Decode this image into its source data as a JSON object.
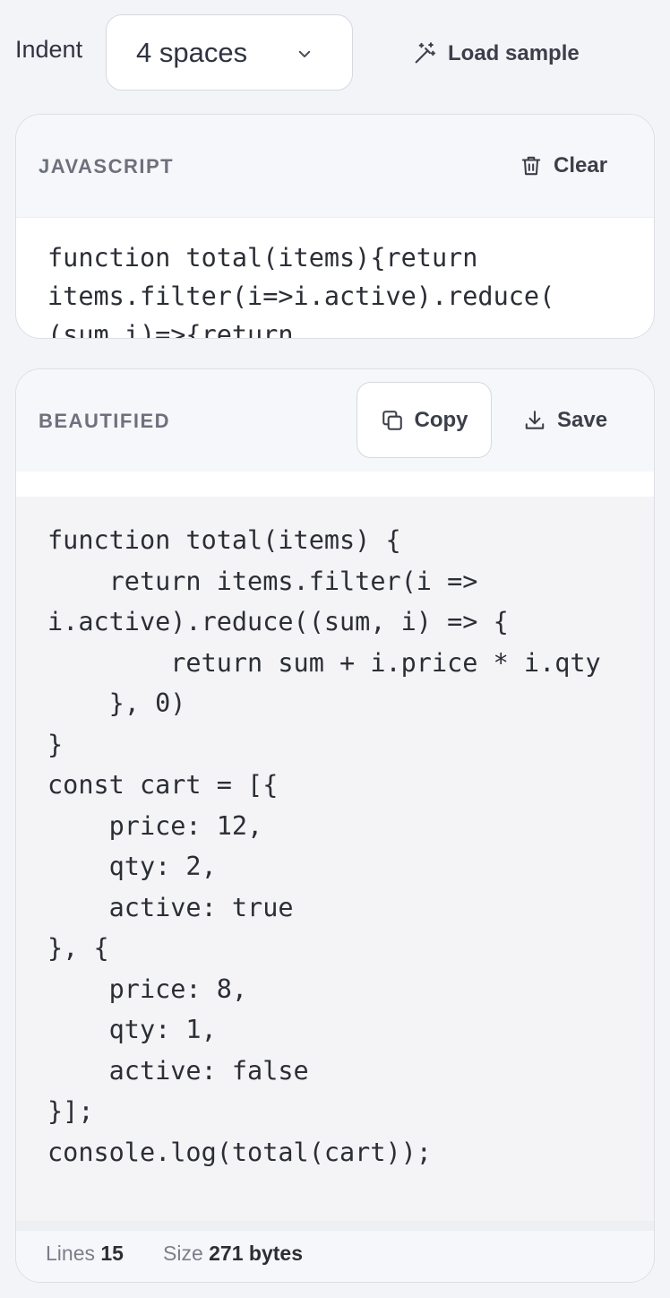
{
  "toolbar": {
    "indent_label": "Indent",
    "indent_value": "4 spaces",
    "load_sample_label": "Load sample"
  },
  "input_panel": {
    "title": "JAVASCRIPT",
    "clear_label": "Clear",
    "code": "function total(items){return\nitems.filter(i=>i.active).reduce(\n(sum,i)=>{return"
  },
  "output_panel": {
    "title": "BEAUTIFIED",
    "copy_label": "Copy",
    "save_label": "Save",
    "code": "function total(items) {\n    return items.filter(i =>\ni.active).reduce((sum, i) => {\n        return sum + i.price * i.qty\n    }, 0)\n}\nconst cart = [{\n    price: 12,\n    qty: 2,\n    active: true\n}, {\n    price: 8,\n    qty: 1,\n    active: false\n}];\nconsole.log(total(cart));"
  },
  "stats": {
    "lines_label": "Lines",
    "lines_value": "15",
    "size_label": "Size",
    "size_value": "271 bytes"
  },
  "colors": {
    "page_bg": "#f3f4f8",
    "card_bg": "#ffffff",
    "header_bg": "#f6f7fa",
    "code_area_bg": "#f4f4f6",
    "muted_text": "#6c717c",
    "text": "#2b2e35"
  },
  "icons": {
    "indent_dropdown": "chevron-down-icon",
    "load_sample": "magic-wand-icon",
    "clear": "trash-icon",
    "copy": "copy-icon",
    "save": "download-icon"
  }
}
